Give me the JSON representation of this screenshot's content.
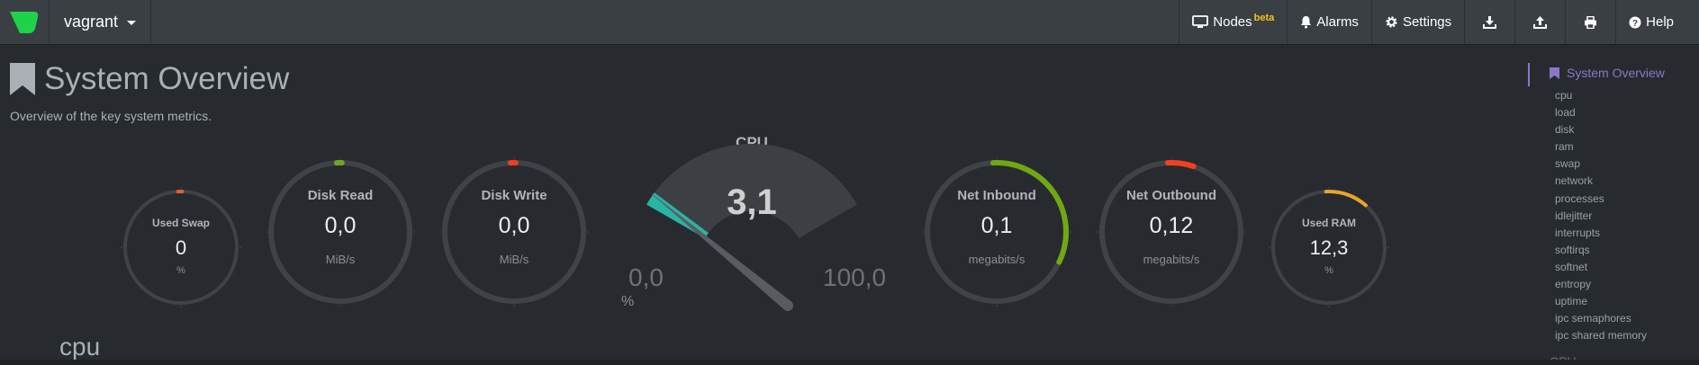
{
  "app": {
    "hostname": "vagrant",
    "brand_color": "#1ed24b"
  },
  "navbar": {
    "items": [
      {
        "label": "Nodes",
        "badge": "beta",
        "icon": "monitor-icon"
      },
      {
        "label": "Alarms",
        "icon": "bell-icon"
      },
      {
        "label": "Settings",
        "icon": "gear-icon"
      },
      {
        "icon": "download-icon"
      },
      {
        "icon": "upload-icon"
      },
      {
        "icon": "print-icon"
      },
      {
        "label": "Help",
        "icon": "question-circle-icon"
      }
    ]
  },
  "page": {
    "title": "System Overview",
    "subtitle": "Overview of the key system metrics."
  },
  "gauges": [
    {
      "id": "used-swap",
      "label": "Used Swap",
      "value": "0",
      "unit": "%",
      "fill": 0.01,
      "color": "#e0622a"
    },
    {
      "id": "disk-read",
      "label": "Disk Read",
      "value": "0,0",
      "unit": "MiB/s",
      "fill": 0.01,
      "color": "#6ea821"
    },
    {
      "id": "disk-write",
      "label": "Disk Write",
      "value": "0,0",
      "unit": "MiB/s",
      "fill": 0.01,
      "color": "#f2401f"
    },
    {
      "id": "net-inbound",
      "label": "Net Inbound",
      "value": "0,1",
      "unit": "megabits/s",
      "fill": 0.33,
      "color": "#70a812"
    },
    {
      "id": "net-outbound",
      "label": "Net Outbound",
      "value": "0,12",
      "unit": "megabits/s",
      "fill": 0.06,
      "color": "#f2401f"
    },
    {
      "id": "used-ram",
      "label": "Used RAM",
      "value": "12,3",
      "unit": "%",
      "fill": 0.123,
      "color": "#e9a42a"
    }
  ],
  "cpu_gauge": {
    "title": "CPU",
    "value": "3,1",
    "min": "0,0",
    "max": "100,0",
    "unit": "%",
    "percent": 3.1,
    "needle_color": "#2bb3a3"
  },
  "section": {
    "title": "cpu"
  },
  "sidebar": {
    "active": "System Overview",
    "items": [
      "cpu",
      "load",
      "disk",
      "ram",
      "swap",
      "network",
      "processes",
      "idlejitter",
      "interrupts",
      "softirqs",
      "softnet",
      "entropy",
      "uptime",
      "ipc semaphores",
      "ipc shared memory"
    ],
    "next": "CPU"
  }
}
